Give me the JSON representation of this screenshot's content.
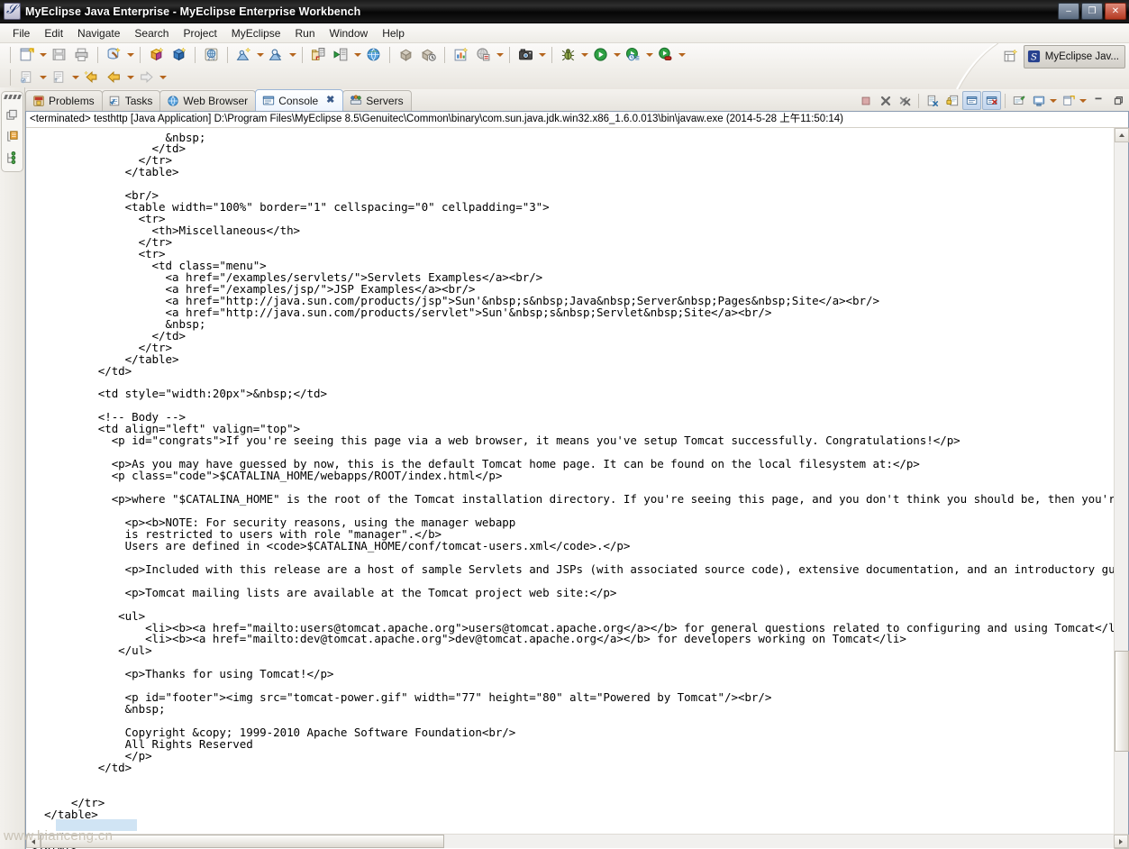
{
  "window": {
    "title": "MyEclipse Java Enterprise - MyEclipse Enterprise Workbench",
    "app_icon": "myeclipse-icon",
    "minimize": "–",
    "maximize": "❐",
    "close": "✕"
  },
  "menu": {
    "items": [
      "File",
      "Edit",
      "Navigate",
      "Search",
      "Project",
      "MyEclipse",
      "Run",
      "Window",
      "Help"
    ]
  },
  "toolbar": {
    "row1": [
      {
        "name": "new-wizard-button",
        "icon": "new-file-icon",
        "dropdown": true
      },
      {
        "name": "save-button",
        "icon": "save-disk-icon",
        "dropdown": false
      },
      {
        "name": "print-button",
        "icon": "printer-icon",
        "dropdown": false
      },
      {
        "sep": true
      },
      {
        "name": "deploy-button",
        "icon": "deploy-icon",
        "dropdown": true
      },
      {
        "sep": true
      },
      {
        "name": "new-ejb-project-button",
        "icon": "cube-yellow-icon",
        "dropdown": false
      },
      {
        "name": "new-web-project-button",
        "icon": "cube-blue-icon",
        "dropdown": false
      },
      {
        "sep": true
      },
      {
        "name": "web-20-button",
        "icon": "globe-20-icon",
        "dropdown": false
      },
      {
        "sep": true
      },
      {
        "name": "new-server-button",
        "icon": "server-new-icon",
        "dropdown": true
      },
      {
        "name": "manage-server-button",
        "icon": "server-manage-icon",
        "dropdown": true
      },
      {
        "sep": true
      },
      {
        "name": "open-db-browser-button",
        "icon": "db-browser-icon",
        "dropdown": false
      },
      {
        "name": "run-server-button",
        "icon": "server-run-icon",
        "dropdown": true
      },
      {
        "name": "open-browser-button",
        "icon": "globe-icon",
        "dropdown": false
      },
      {
        "sep": true
      },
      {
        "name": "deploy-app-button",
        "icon": "package-icon",
        "dropdown": false
      },
      {
        "name": "undeploy-app-button",
        "icon": "package-remove-icon",
        "dropdown": false
      },
      {
        "sep": true
      },
      {
        "name": "report-designer-button",
        "icon": "chart-new-icon",
        "dropdown": false
      },
      {
        "name": "web-report-button",
        "icon": "globe-report-icon",
        "dropdown": true
      },
      {
        "sep": true
      },
      {
        "name": "snapshot-button",
        "icon": "camera-icon",
        "dropdown": true
      },
      {
        "sep": true
      },
      {
        "name": "debug-button",
        "icon": "bug-icon",
        "dropdown": true
      },
      {
        "name": "run-button",
        "icon": "run-green-icon",
        "dropdown": true
      },
      {
        "name": "run-history-button",
        "icon": "run-history-icon",
        "dropdown": true
      },
      {
        "name": "run-external-tools-button",
        "icon": "run-tools-icon",
        "dropdown": true
      }
    ],
    "row2": [
      {
        "name": "new-java-class-button",
        "icon": "new-class-icon",
        "dropdown": true
      },
      {
        "name": "new-java-interface-button",
        "icon": "new-interface-icon",
        "dropdown": true
      },
      {
        "name": "previous-annotation-button",
        "icon": "prev-annotation-icon",
        "dropdown": false
      },
      {
        "name": "back-button",
        "icon": "back-arrow-icon",
        "dropdown": true
      },
      {
        "name": "forward-button",
        "icon": "forward-arrow-icon",
        "dropdown": true
      }
    ],
    "right_group": [
      {
        "name": "open-perspective-button",
        "icon": "open-perspective-icon",
        "dropdown": false
      },
      {
        "name": "new-window-button",
        "icon": "new-window-icon",
        "dropdown": false
      },
      {
        "name": "myeclipse-config-button",
        "icon": "myeclipse-green-icon",
        "dropdown": true
      },
      {
        "sep": true
      },
      {
        "name": "open-resource-button",
        "icon": "folder-open-icon",
        "dropdown": false
      },
      {
        "name": "quick-fix-button",
        "icon": "pencil-icon",
        "dropdown": true
      },
      {
        "name": "open-type-button",
        "icon": "folder-yellow-icon",
        "dropdown": false
      }
    ]
  },
  "perspective": {
    "open_icon": "open-perspective-icon",
    "current_label": "MyEclipse Jav...",
    "current_icon": "myeclipse-icon"
  },
  "fastview": {
    "icons": [
      "restore-icon",
      "package-explorer-icon",
      "outline-icon"
    ]
  },
  "view_tabs": [
    {
      "label": "Problems",
      "icon": "problems-icon",
      "active": false,
      "closable": false
    },
    {
      "label": "Tasks",
      "icon": "tasks-icon",
      "active": false,
      "closable": false
    },
    {
      "label": "Web Browser",
      "icon": "web-browser-icon",
      "active": false,
      "closable": false
    },
    {
      "label": "Console",
      "icon": "console-icon",
      "active": true,
      "closable": true
    },
    {
      "label": "Servers",
      "icon": "servers-icon",
      "active": false,
      "closable": false
    }
  ],
  "view_toolbar": [
    {
      "name": "terminate-button",
      "icon": "terminate-stop-icon",
      "toggled": false
    },
    {
      "name": "remove-launch-button",
      "icon": "remove-x-icon",
      "toggled": false
    },
    {
      "name": "remove-all-terminated-button",
      "icon": "remove-all-x-icon",
      "toggled": false
    },
    {
      "sep": true
    },
    {
      "name": "clear-console-button",
      "icon": "clear-console-icon",
      "toggled": false
    },
    {
      "name": "scroll-lock-button",
      "icon": "scroll-lock-icon",
      "toggled": false
    },
    {
      "name": "pin-console-button",
      "icon": "pin-console-icon",
      "toggled": true
    },
    {
      "name": "show-console-on-error-button",
      "icon": "console-error-icon",
      "toggled": true
    },
    {
      "sep": true
    },
    {
      "name": "show-console-output-button",
      "icon": "console-output-icon",
      "toggled": false
    },
    {
      "name": "display-selected-console-button",
      "icon": "display-console-icon",
      "toggled": false,
      "dropdown": true
    },
    {
      "name": "open-console-button",
      "icon": "open-console-icon",
      "toggled": false,
      "dropdown": true
    },
    {
      "name": "minimize-view-button",
      "icon": "minimize-icon",
      "toggled": false
    },
    {
      "name": "maximize-view-button",
      "icon": "maximize-icon",
      "toggled": false
    }
  ],
  "console": {
    "process_line": "<terminated> testhttp [Java Application] D:\\Program Files\\MyEclipse 8.5\\Genuitec\\Common\\binary\\com.sun.java.jdk.win32.x86_1.6.0.013\\bin\\javaw.exe (2014-5-28 上午11:50:14)",
    "output": "                    &nbsp;\n                  </td>\n                </tr>\n              </table>\n\n              <br/>\n              <table width=\"100%\" border=\"1\" cellspacing=\"0\" cellpadding=\"3\">\n                <tr>\n                  <th>Miscellaneous</th>\n                </tr>\n                <tr>\n                  <td class=\"menu\">\n                    <a href=\"/examples/servlets/\">Servlets Examples</a><br/>\n                    <a href=\"/examples/jsp/\">JSP Examples</a><br/>\n                    <a href=\"http://java.sun.com/products/jsp\">Sun'&nbsp;s&nbsp;Java&nbsp;Server&nbsp;Pages&nbsp;Site</a><br/>\n                    <a href=\"http://java.sun.com/products/servlet\">Sun'&nbsp;s&nbsp;Servlet&nbsp;Site</a><br/>\n                    &nbsp;\n                  </td>\n                </tr>\n              </table>\n          </td>\n\n          <td style=\"width:20px\">&nbsp;</td>\n\n          <!-- Body -->\n          <td align=\"left\" valign=\"top\">\n            <p id=\"congrats\">If you're seeing this page via a web browser, it means you've setup Tomcat successfully. Congratulations!</p>\n\n            <p>As you may have guessed by now, this is the default Tomcat home page. It can be found on the local filesystem at:</p>\n            <p class=\"code\">$CATALINA_HOME/webapps/ROOT/index.html</p>\n\n            <p>where \"$CATALINA_HOME\" is the root of the Tomcat installation directory. If you're seeing this page, and you don't think you should be, then you're either a u\n\n              <p><b>NOTE: For security reasons, using the manager webapp\n              is restricted to users with role \"manager\".</b>\n              Users are defined in <code>$CATALINA_HOME/conf/tomcat-users.xml</code>.</p>\n\n              <p>Included with this release are a host of sample Servlets and JSPs (with associated source code), extensive documentation, and an introductory guide to devel\n\n              <p>Tomcat mailing lists are available at the Tomcat project web site:</p>\n\n             <ul>\n                 <li><b><a href=\"mailto:users@tomcat.apache.org\">users@tomcat.apache.org</a></b> for general questions related to configuring and using Tomcat</li>\n                 <li><b><a href=\"mailto:dev@tomcat.apache.org\">dev@tomcat.apache.org</a></b> for developers working on Tomcat</li>\n             </ul>\n\n              <p>Thanks for using Tomcat!</p>\n\n              <p id=\"footer\"><img src=\"tomcat-power.gif\" width=\"77\" height=\"80\" alt=\"Powered by Tomcat\"/><br/>\n              &nbsp;\n\n              Copyright &copy; 1999-2010 Apache Software Foundation<br/>\n              All Rights Reserved\n              </p>\n          </td>\n\n\n      </tr>\n  </table>\n\n</body>\n</html>"
  },
  "watermark": "www.bianceng.cn",
  "colors": {
    "accent_orange": "#b5651d",
    "tab_active_border": "#9cb6d6",
    "console_text": "#000000",
    "titlebar": "#0a0a0a"
  }
}
